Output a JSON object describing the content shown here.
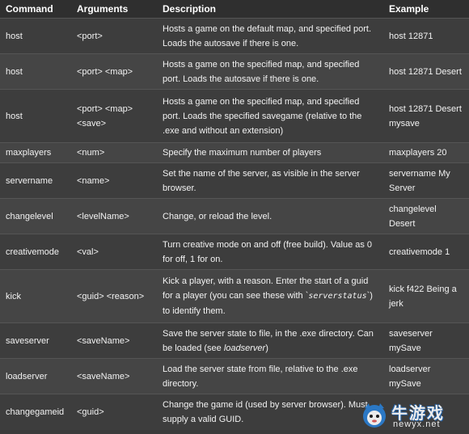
{
  "table": {
    "headers": [
      "Command",
      "Arguments",
      "Description",
      "Example"
    ],
    "rows": [
      {
        "command": "host",
        "arguments": "<port>",
        "description": "Hosts a game on the default map, and specified port. Loads the autosave if there is one.",
        "example": "host 12871"
      },
      {
        "command": "host",
        "arguments": "<port> <map>",
        "description": "Hosts a game on the specified map, and specified port. Loads the autosave if there is one.",
        "example": "host 12871 Desert"
      },
      {
        "command": "host",
        "arguments": "<port> <map> <save>",
        "description": "Hosts a game on the specified map, and specified port. Loads the specified savegame (relative to the .exe and without an extension)",
        "example": "host 12871 Desert mysave"
      },
      {
        "command": "maxplayers",
        "arguments": "<num>",
        "description": "Specify the maximum number of players",
        "example": "maxplayers 20"
      },
      {
        "command": "servername",
        "arguments": "<name>",
        "description": "Set the name of the server, as visible in the server browser.",
        "example": "servername My Server"
      },
      {
        "command": "changelevel",
        "arguments": "<levelName>",
        "description": "Change, or reload the level.",
        "example": "changelevel Desert"
      },
      {
        "command": "creativemode",
        "arguments": "<val>",
        "description": "Turn creative mode on and off (free build). Value as 0 for off, 1 for on.",
        "example": "creativemode 1"
      },
      {
        "command": "kick",
        "arguments": "<guid> <reason>",
        "description_parts": [
          "Kick a player, with a reason. Enter the start of a guid for a player (you can see these with `",
          "serverstatus",
          "`) to identify them."
        ],
        "example": "kick f422 Being a jerk"
      },
      {
        "command": "saveserver",
        "arguments": "<saveName>",
        "description_parts": [
          "Save the server state to file, in the .exe directory. Can be loaded (see ",
          "loadserver",
          ")"
        ],
        "example": "saveserver mySave"
      },
      {
        "command": "loadserver",
        "arguments": "<saveName>",
        "description": "Load the server state from file, relative to the .exe directory.",
        "example": "loadserver mySave"
      },
      {
        "command": "changegameid",
        "arguments": "<guid>",
        "description": "Change the game id (used by server browser). Must supply a valid GUID.",
        "example": ""
      }
    ]
  },
  "watermark": {
    "title": "牛游戏",
    "url": "newyx.net"
  }
}
